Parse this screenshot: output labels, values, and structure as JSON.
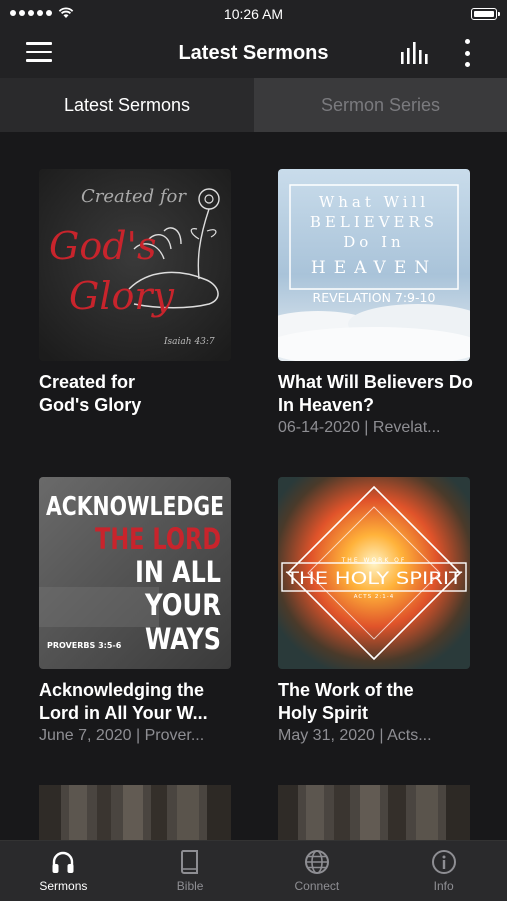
{
  "status": {
    "time": "10:26 AM"
  },
  "header": {
    "title": "Latest Sermons"
  },
  "tabs": [
    {
      "label": "Latest Sermons",
      "active": true
    },
    {
      "label": "Sermon Series",
      "active": false
    }
  ],
  "sermons": [
    {
      "title": "Created for God's Glory",
      "meta": "",
      "art": {
        "line1": "Created for",
        "line2": "God's",
        "line3": "Glory",
        "ref": "Isaiah 43:7"
      }
    },
    {
      "title": "What Will Believers Do In Heaven?",
      "meta": "06-14-2020 | Revelat...",
      "art": {
        "line1": "What Will",
        "line2": "BELIEVERS",
        "line3": "Do In",
        "line4": "HEAVEN",
        "ref": "REVELATION 7:9-10"
      }
    },
    {
      "title": "Acknowledging the Lord in All Your W...",
      "meta": "June 7, 2020 | Prover...",
      "art": {
        "line1": "ACKNOWLEDGE",
        "line2": "THE LORD",
        "line3": "IN ALL",
        "line4": "YOUR",
        "line5": "WAYS",
        "ref": "PROVERBS 3:5-6"
      }
    },
    {
      "title": "The Work of the Holy Spirit",
      "meta": "May 31, 2020 | Acts...",
      "art": {
        "top": "THE WORK OF",
        "main": "THE HOLY SPIRIT",
        "ref": "ACTS 2:1-4"
      }
    }
  ],
  "bottom_tabs": [
    {
      "label": "Sermons",
      "icon": "headphones-icon",
      "active": true
    },
    {
      "label": "Bible",
      "icon": "book-icon",
      "active": false
    },
    {
      "label": "Connect",
      "icon": "globe-icon",
      "active": false
    },
    {
      "label": "Info",
      "icon": "info-icon",
      "active": false
    }
  ],
  "colors": {
    "accent_red": "#c8242c",
    "background": "#18181a",
    "secondary_text": "#8e8e93"
  }
}
